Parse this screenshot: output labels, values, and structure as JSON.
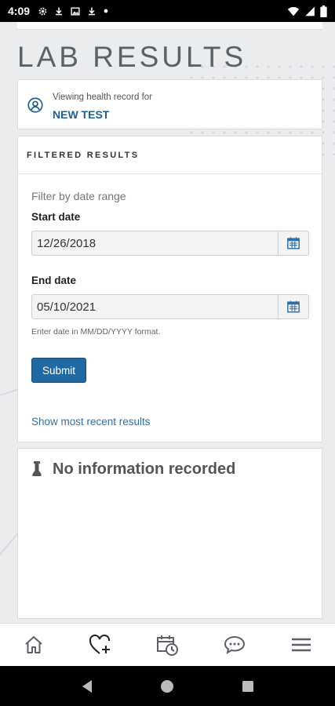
{
  "status_bar": {
    "time": "4:09"
  },
  "page": {
    "title": "LAB RESULTS"
  },
  "record": {
    "label": "Viewing health record for",
    "name": "NEW TEST"
  },
  "filter": {
    "header": "FILTERED RESULTS",
    "range_label": "Filter by date range",
    "start_label": "Start date",
    "start_value": "12/26/2018",
    "end_label": "End date",
    "end_value": "05/10/2021",
    "hint": "Enter date in MM/DD/YYYY format.",
    "submit_label": "Submit",
    "recent_link": "Show most recent results"
  },
  "results": {
    "empty_text": "No information recorded"
  },
  "nav": {
    "items": [
      "home-icon",
      "health-record-icon",
      "appointments-icon",
      "messages-icon",
      "menu-icon"
    ]
  },
  "colors": {
    "accent": "#1f6aa5",
    "link": "#2d6fa6",
    "title": "#5b6168"
  }
}
